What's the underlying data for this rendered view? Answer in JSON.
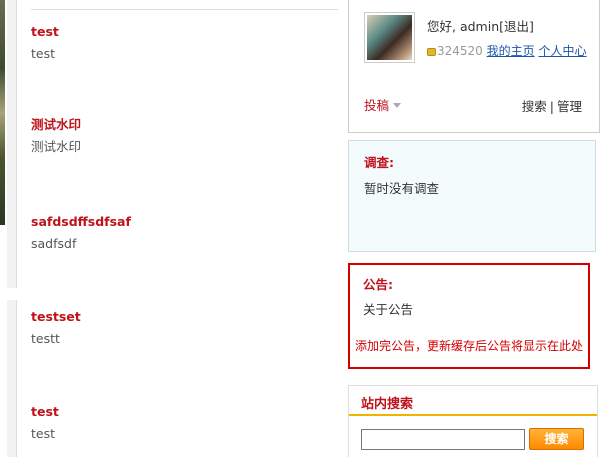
{
  "posts": [
    {
      "title": "test",
      "excerpt": "test"
    },
    {
      "title": "测试水印",
      "excerpt": "测试水印"
    },
    {
      "title": "safdsdffsdfsaf",
      "excerpt": "sadfsdf"
    },
    {
      "title": "testset",
      "excerpt": "testt"
    },
    {
      "title": "test",
      "excerpt": "test"
    }
  ],
  "user": {
    "greeting": "您好, admin",
    "logout": "[退出]",
    "credits": "324520",
    "home_link": "我的主页",
    "center_link": "个人中心",
    "contribute": "投稿",
    "search_link": "搜索",
    "separator": "|",
    "manage_link": "管理"
  },
  "survey": {
    "title": "调查:",
    "body": "暂时没有调查"
  },
  "notice": {
    "title": "公告:",
    "body": "关于公告",
    "hint": "添加完公告，更新缓存后公告将显示在此处"
  },
  "site_search": {
    "title": "站内搜索",
    "input_value": "",
    "button": "搜索"
  },
  "colors": {
    "accent_red": "#c1121b",
    "link_blue": "#1a57a8",
    "notice_border": "#d40000",
    "search_button": "#ff8a00"
  }
}
